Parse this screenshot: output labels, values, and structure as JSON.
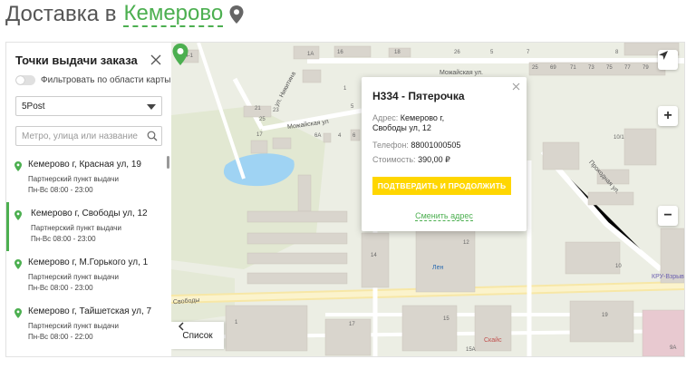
{
  "heading": {
    "prefix": "Доставка в",
    "city": "Кемерово"
  },
  "sidebar": {
    "title": "Точки выдачи заказа",
    "filter_label": "Фильтровать по области карты",
    "provider_select": "5Post",
    "search_placeholder": "Метро, улица или название",
    "items": [
      {
        "address": "Кемерово г, Красная ул, 19",
        "type": "Партнерский пункт выдачи",
        "hours": "Пн-Вс 08:00 - 23:00"
      },
      {
        "address": "Кемерово г, Свободы ул, 12",
        "type": "Партнерский пункт выдачи",
        "hours": "Пн-Вс 08:00 - 23:00"
      },
      {
        "address": "Кемерово г, М.Горького ул, 1",
        "type": "Партнерский пункт выдачи",
        "hours": "Пн-Вс 08:00 - 23:00"
      },
      {
        "address": "Кемерово г, Тайшетская ул, 7",
        "type": "Партнерский пункт выдачи",
        "hours": "Пн-Вс 08:00 - 22:00"
      }
    ],
    "active_index": 1
  },
  "popup": {
    "title": "Н334 - Пятерочка",
    "address_label": "Адрес:",
    "address_value_line1": "Кемерово г,",
    "address_value_line2": "Свободы ул, 12",
    "phone_label": "Телефон:",
    "phone_value": "88001000505",
    "cost_label": "Стоимость:",
    "cost_value": "390,00 ₽",
    "confirm_button": "ПОДТВЕРДИТЬ И ПРОДОЛЖИТЬ",
    "change_link": "Сменить адрес"
  },
  "map": {
    "list_button": "Список",
    "zoom_in": "+",
    "zoom_out": "−",
    "street_labels": {
      "mozhayskaya_1": "Можайская ул.",
      "mozhayskaya_2": "Можайская ул",
      "nikitina": "ул. Никитина",
      "prokhodnaya": "Проходная ул.",
      "svobody": "Свободы"
    },
    "poi_labels": {
      "lenta": "Лен",
      "kru": "КРУ-Взрыв",
      "skais": "Скайс"
    },
    "house_numbers": [
      "44-1",
      "1А",
      "16",
      "18",
      "26",
      "5",
      "7",
      "8",
      "25",
      "69",
      "71",
      "73",
      "75",
      "77",
      "79",
      "9А",
      "21",
      "23",
      "25",
      "17",
      "6А",
      "4",
      "6",
      "5",
      "1",
      "10/1",
      "12",
      "14",
      "10",
      "17",
      "15",
      "19",
      "15А",
      "9А",
      "1"
    ]
  },
  "colors": {
    "accent": "#4caf50",
    "button": "#ffd600",
    "water": "#9fd3f3",
    "building": "#d8d4cc",
    "road": "#ffffff",
    "park": "#e6ead8"
  }
}
